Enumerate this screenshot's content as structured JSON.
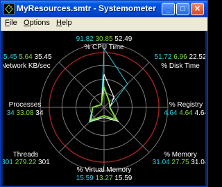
{
  "window": {
    "title": "MyResources.smtr - Systemometer"
  },
  "titlebar": {
    "minimize_glyph": "_",
    "maximize_glyph": "□",
    "close_glyph": "✕"
  },
  "menu": [
    {
      "label": "File",
      "mnemonic": "F",
      "rest": "ile"
    },
    {
      "label": "Options",
      "mnemonic": "O",
      "rest": "ptions"
    },
    {
      "label": "Help",
      "mnemonic": "H",
      "rest": "elp"
    }
  ],
  "colors": {
    "value_a": "#2ecfd8",
    "value_b": "#7fdc3a",
    "value_c": "#ffffff",
    "ring": "#9b2020",
    "axis": "#7a7a7a",
    "ring_inner": "#808080"
  },
  "metrics": [
    {
      "name": "% CPU Time",
      "v1": "91.82",
      "v2": "30.85",
      "v3": "52.49"
    },
    {
      "name": "% Disk Time",
      "v1": "51.72",
      "v2": "6.96",
      "v3": "22.52"
    },
    {
      "name": "% Registry",
      "v1": "4.64",
      "v2": "4.64",
      "v3": "4.64"
    },
    {
      "name": "% Memory",
      "v1": "31.04",
      "v2": "27.75",
      "v3": "31.04"
    },
    {
      "name": "% Virtual Memory",
      "v1": "15.59",
      "v2": "13.27",
      "v3": "15.59"
    },
    {
      "name": "Threads",
      "v1": "301",
      "v2": "279.22",
      "v3": "301"
    },
    {
      "name": "Processes",
      "v1": "34",
      "v2": "33.08",
      "v3": "34"
    },
    {
      "name": "Network KB/sec",
      "v1": "35.45",
      "v2": "5.64",
      "v3": "35.45"
    }
  ],
  "radar": {
    "max_fraction": [
      0.92,
      0.52,
      0.09,
      0.31,
      0.16,
      0.33,
      0.18,
      0.06
    ],
    "avg_fraction": [
      0.31,
      0.12,
      0.09,
      0.28,
      0.13,
      0.29,
      0.18,
      0.06
    ],
    "cur_fraction": [
      0.52,
      0.22,
      0.09,
      0.31,
      0.16,
      0.31,
      0.18,
      0.06
    ]
  }
}
